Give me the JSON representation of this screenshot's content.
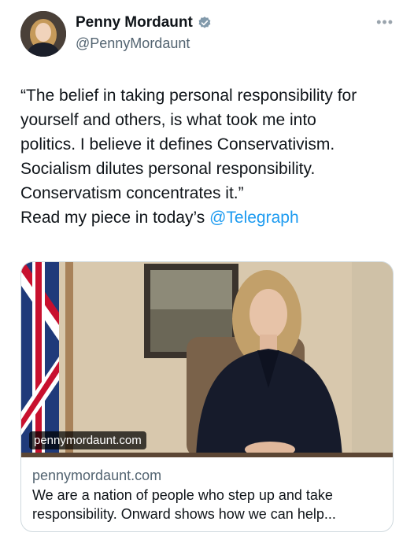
{
  "author": {
    "display_name": "Penny Mordaunt",
    "handle": "@PennyMordaunt",
    "verified": true,
    "avatar_icon": "profile-photo"
  },
  "more_label": "•••",
  "tweet": {
    "lines": [
      "“The belief in taking personal responsibility for",
      "yourself and others, is what took me into",
      "politics. I believe it defines Conservativism.",
      "Socialism dilutes personal responsibility.",
      "Conservatism concentrates it.”"
    ],
    "last_line_prefix": "Read my piece in today’s ",
    "mention": "@Telegraph"
  },
  "card": {
    "image_badge": "pennymordaunt.com",
    "domain": "pennymordaunt.com",
    "description_lines": [
      "We are a nation of people who step up and take",
      "responsibility. Onward shows how we can help..."
    ]
  },
  "colors": {
    "link": "#1d9bf0",
    "verified": "#829aab",
    "secondary_text": "#536471"
  }
}
